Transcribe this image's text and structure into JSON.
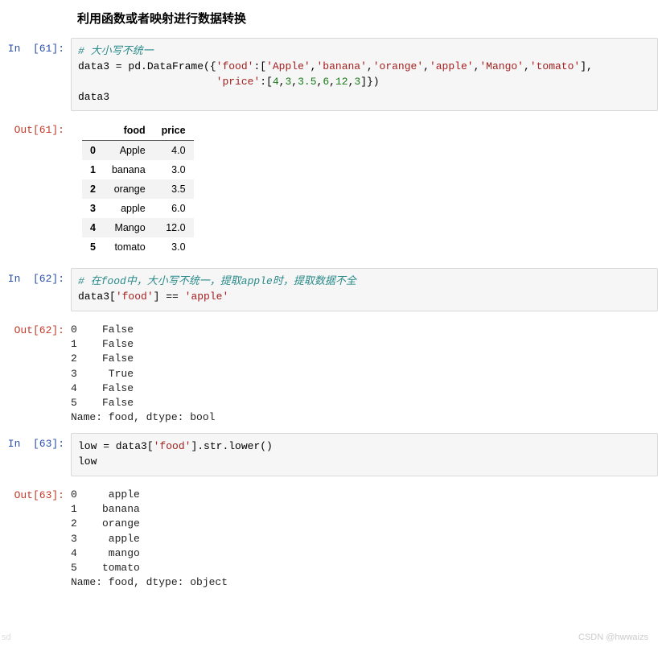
{
  "title": "利用函数或者映射进行数据转换",
  "cells": {
    "c61": {
      "in_prompt": "In  [61]:",
      "out_prompt": "Out[61]:",
      "code_comment": "# 大小写不统一",
      "code_l2a": "data3 = pd.DataFrame({",
      "code_l2_key_food": "'food'",
      "code_l2b": ":[",
      "code_l2_s1": "'Apple'",
      "code_l2_c1": ",",
      "code_l2_s2": "'banana'",
      "code_l2_c2": ",",
      "code_l2_s3": "'orange'",
      "code_l2_c3": ",",
      "code_l2_s4": "'apple'",
      "code_l2_c4": ",",
      "code_l2_s5": "'Mango'",
      "code_l2_c5": ",",
      "code_l2_s6": "'tomato'",
      "code_l2_end": "],",
      "code_l3_pad": "                      ",
      "code_l3_key_price": "'price'",
      "code_l3b": ":[",
      "code_l3_n1": "4",
      "code_l3_n2": "3",
      "code_l3_n3": "3.5",
      "code_l3_n4": "6",
      "code_l3_n5": "12",
      "code_l3_n6": "3",
      "code_l3_end": "]})",
      "code_l4": "data3",
      "table": {
        "cols": [
          "",
          "food",
          "price"
        ],
        "rows": [
          {
            "idx": "0",
            "food": "Apple",
            "price": "4.0"
          },
          {
            "idx": "1",
            "food": "banana",
            "price": "3.0"
          },
          {
            "idx": "2",
            "food": "orange",
            "price": "3.5"
          },
          {
            "idx": "3",
            "food": "apple",
            "price": "6.0"
          },
          {
            "idx": "4",
            "food": "Mango",
            "price": "12.0"
          },
          {
            "idx": "5",
            "food": "tomato",
            "price": "3.0"
          }
        ]
      }
    },
    "c62": {
      "in_prompt": "In  [62]:",
      "out_prompt": "Out[62]:",
      "code_comment": "# 在food中，大小写不统一，提取apple时，提取数据不全",
      "code_l2a": "data3[",
      "code_l2_s1": "'food'",
      "code_l2b": "] == ",
      "code_l2_s2": "'apple'",
      "output": "0    False\n1    False\n2    False\n3     True\n4    False\n5    False\nName: food, dtype: bool"
    },
    "c63": {
      "in_prompt": "In  [63]:",
      "out_prompt": "Out[63]:",
      "code_l1a": "low = data3[",
      "code_l1_s1": "'food'",
      "code_l1b": "].str.lower()",
      "code_l2": "low",
      "output": "0     apple\n1    banana\n2    orange\n3     apple\n4     mango\n5    tomato\nName: food, dtype: object"
    }
  },
  "watermark_right": "CSDN @hwwaizs",
  "watermark_left": "sd"
}
